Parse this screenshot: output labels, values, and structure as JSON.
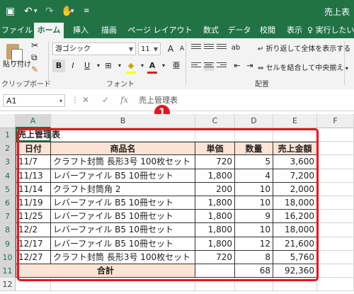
{
  "title_bar": {
    "title": "売上表"
  },
  "ribbon_tabs": [
    "ファイル",
    "ホーム",
    "挿入",
    "描画",
    "ページ レイアウト",
    "数式",
    "データ",
    "校閲",
    "表示"
  ],
  "tell_me": "実行したい作",
  "ribbon": {
    "paste_label": "貼り付け",
    "clipboard_label": "クリップボード",
    "font_name": "游ゴシック",
    "font_size": "11",
    "font_label": "フォント",
    "bold": "B",
    "italic": "I",
    "underline": "U",
    "font_color": "A",
    "wrap_text": "折り返して全体を表示する",
    "merge_center": "セルを結合して中央揃え",
    "alignment_label": "配置"
  },
  "formula_bar": {
    "name_box": "A1",
    "content": "売上管理表",
    "fx": "fx"
  },
  "callout_number": "1",
  "columns": [
    "A",
    "B",
    "C",
    "D",
    "E",
    "F"
  ],
  "rows": [
    "1",
    "2",
    "3",
    "4",
    "5",
    "6",
    "7",
    "8",
    "9",
    "10",
    "11",
    "12"
  ],
  "sheet": {
    "title": "売上管理表",
    "headers": [
      "日付",
      "商品名",
      "単価",
      "数量",
      "売上金額"
    ],
    "data": [
      [
        "11/7",
        "クラフト封筒 長形3号 100枚セット",
        "720",
        "5",
        "3,600"
      ],
      [
        "11/13",
        "レバーファイル B5 10冊セット",
        "1,800",
        "4",
        "7,200"
      ],
      [
        "11/14",
        "クラフト封筒角 2",
        "200",
        "10",
        "2,000"
      ],
      [
        "11/19",
        "レバーファイル B5 10冊セット",
        "1,800",
        "10",
        "18,000"
      ],
      [
        "11/25",
        "レバーファイル B5 10冊セット",
        "1,800",
        "9",
        "16,200"
      ],
      [
        "12/2",
        "レバーファイル B5 10冊セット",
        "1,800",
        "10",
        "18,000"
      ],
      [
        "12/17",
        "レバーファイル B5 10冊セット",
        "1,800",
        "12",
        "21,600"
      ],
      [
        "12/27",
        "クラフト封筒 長形3号 100枚セット",
        "720",
        "8",
        "5,760"
      ]
    ],
    "total_label": "合計",
    "total_qty": "68",
    "total_amount": "92,360"
  }
}
